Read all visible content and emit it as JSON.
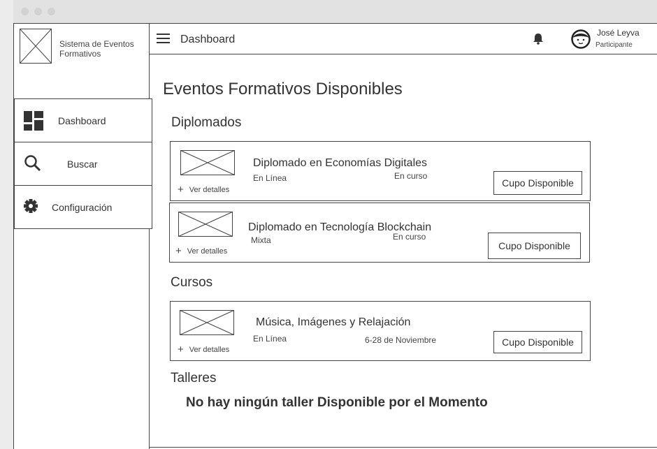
{
  "app": {
    "brand": "Sistema de Eventos Formativos",
    "page_title": "Dashboard"
  },
  "sidebar": {
    "items": [
      {
        "label": "Dashboard",
        "icon": "dashboard-icon"
      },
      {
        "label": "Buscar",
        "icon": "search-icon"
      },
      {
        "label": "Configuración",
        "icon": "gear-icon"
      }
    ]
  },
  "user": {
    "name": "José Leyva",
    "role": "Participante"
  },
  "main": {
    "title": "Eventos Formativos Disponibles",
    "sections": {
      "diplomados": {
        "title": "Diplomados",
        "items": [
          {
            "title": "Diplomado en Economías Digitales",
            "modality": "En Línea",
            "status": "En curso",
            "details": "Ver detalles",
            "button": "Cupo Disponible"
          },
          {
            "title": "Diplomado en Tecnología Blockchain",
            "modality": "Mixta",
            "status": "En curso",
            "details": "Ver detalles",
            "button": "Cupo Disponible"
          }
        ]
      },
      "cursos": {
        "title": "Cursos",
        "items": [
          {
            "title": "Música, Imágenes y Relajación",
            "modality": "En Línea",
            "status": "6-28 de Noviembre",
            "details": "Ver detalles",
            "button": "Cupo Disponible"
          }
        ]
      },
      "talleres": {
        "title": "Talleres",
        "empty_message": "No hay ningún taller Disponible por el Momento"
      }
    }
  },
  "colors": {
    "border": "#444444",
    "background": "#ffffff",
    "chrome": "#e2e2e2"
  }
}
